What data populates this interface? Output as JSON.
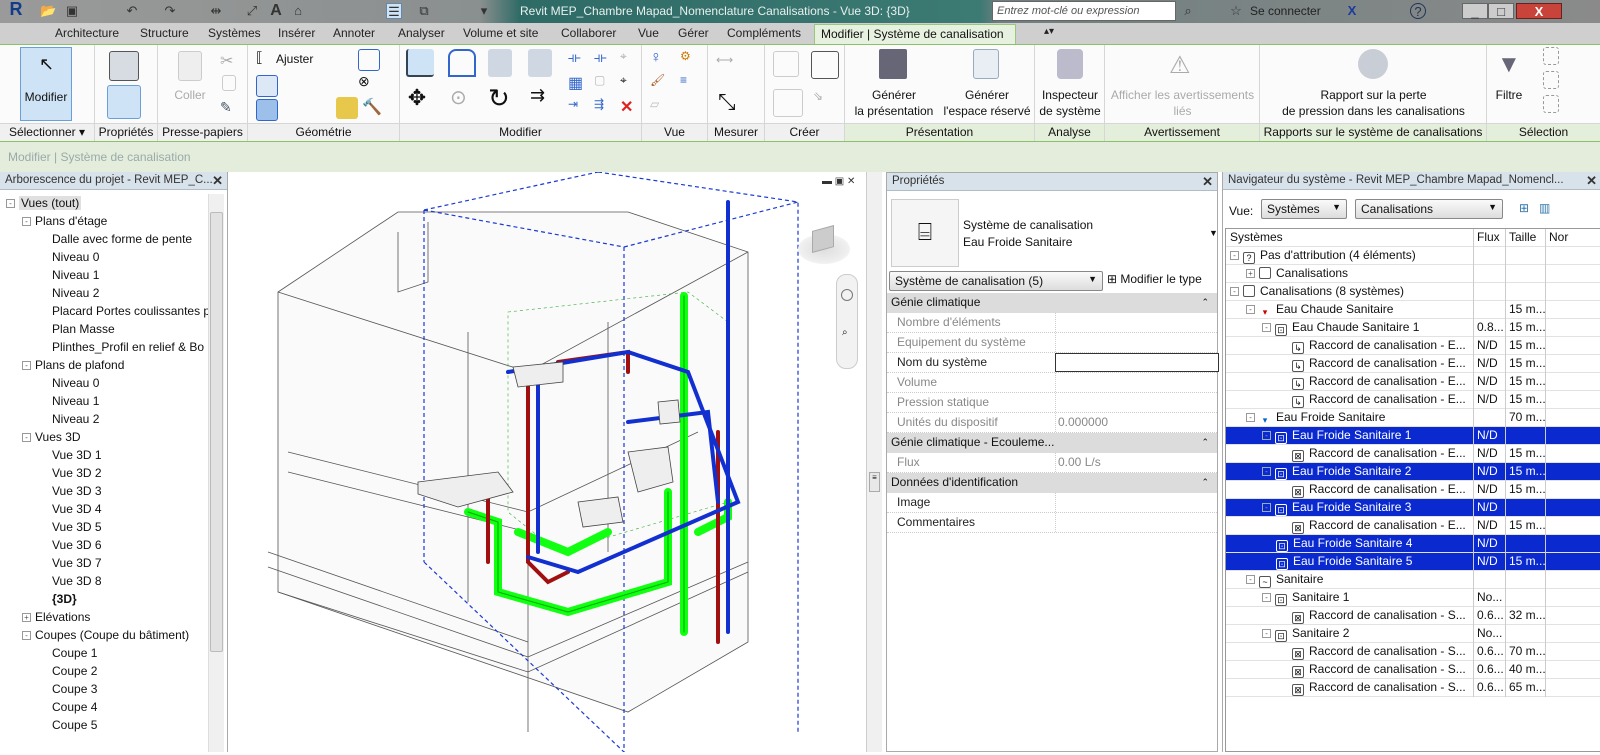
{
  "app": {
    "title": "Revit MEP_Chambre Mapad_Nomenclature Canalisations - Vue 3D: {3D}",
    "search_placeholder": "Entrez mot-clé ou expression",
    "sign_in": "Se connecter"
  },
  "tabs": [
    "Architecture",
    "Structure",
    "Systèmes",
    "Insérer",
    "Annoter",
    "Analyser",
    "Volume et site",
    "Collaborer",
    "Vue",
    "Gérer",
    "Compléments"
  ],
  "active_tab": "Modifier | Système de canalisation",
  "ribbon": {
    "panels": [
      "Sélectionner ▾",
      "Propriétés",
      "Presse-papiers",
      "Géométrie",
      "Modifier",
      "Vue",
      "Mesurer",
      "Créer",
      "Présentation",
      "Analyse",
      "Avertissement",
      "Rapports sur le système de canalisations",
      "Sélection"
    ],
    "modify": "Modifier",
    "paste": "Coller",
    "trim": "Ajuster",
    "gen_layout": [
      "Générer",
      "la présentation"
    ],
    "gen_space": [
      "Générer",
      "l'espace réservé"
    ],
    "inspector": [
      "Inspecteur",
      "de système"
    ],
    "warnings": [
      "Afficher les avertissements",
      "liés"
    ],
    "report": [
      "Rapport sur la perte",
      "de pression dans les canalisations"
    ],
    "filter": "Filtre"
  },
  "options_bar": "Modifier | Système de canalisation",
  "browser": {
    "title": "Arborescence du projet - Revit MEP_C...",
    "items": [
      {
        "l": "Vues (tout)",
        "d": 0,
        "t": "-"
      },
      {
        "l": "Plans d'étage",
        "d": 1,
        "t": "-"
      },
      {
        "l": "Dalle avec forme de pente",
        "d": 2
      },
      {
        "l": "Niveau 0",
        "d": 2
      },
      {
        "l": "Niveau 1",
        "d": 2
      },
      {
        "l": "Niveau 2",
        "d": 2
      },
      {
        "l": "Placard Portes coulissantes pl",
        "d": 2
      },
      {
        "l": "Plan Masse",
        "d": 2
      },
      {
        "l": "Plinthes_Profil en relief & Bo",
        "d": 2
      },
      {
        "l": "Plans de plafond",
        "d": 1,
        "t": "-"
      },
      {
        "l": "Niveau 0",
        "d": 2
      },
      {
        "l": "Niveau 1",
        "d": 2
      },
      {
        "l": "Niveau 2",
        "d": 2
      },
      {
        "l": "Vues 3D",
        "d": 1,
        "t": "-"
      },
      {
        "l": "Vue 3D 1",
        "d": 2
      },
      {
        "l": "Vue 3D 2",
        "d": 2
      },
      {
        "l": "Vue 3D 3",
        "d": 2
      },
      {
        "l": "Vue 3D 4",
        "d": 2
      },
      {
        "l": "Vue 3D 5",
        "d": 2
      },
      {
        "l": "Vue 3D 6",
        "d": 2
      },
      {
        "l": "Vue 3D 7",
        "d": 2
      },
      {
        "l": "Vue 3D 8",
        "d": 2
      },
      {
        "l": "{3D}",
        "d": 2,
        "b": true
      },
      {
        "l": "Elévations",
        "d": 1,
        "t": "+"
      },
      {
        "l": "Coupes (Coupe du bâtiment)",
        "d": 1,
        "t": "-"
      },
      {
        "l": "Coupe 1",
        "d": 2
      },
      {
        "l": "Coupe 2",
        "d": 2
      },
      {
        "l": "Coupe 3",
        "d": 2
      },
      {
        "l": "Coupe 4",
        "d": 2
      },
      {
        "l": "Coupe 5",
        "d": 2
      }
    ]
  },
  "properties": {
    "title": "Propriétés",
    "type_line1": "Système de canalisation",
    "type_line2": "Eau Froide Sanitaire",
    "selector": "Système de canalisation (5)",
    "edit_type": "Modifier le type",
    "groups": [
      {
        "name": "Génie climatique",
        "rows": [
          {
            "k": "Nombre d'éléments",
            "v": ""
          },
          {
            "k": "Equipement du système",
            "v": ""
          },
          {
            "k": "Nom du système",
            "v": "",
            "active": true
          },
          {
            "k": "Volume",
            "v": ""
          },
          {
            "k": "Pression statique",
            "v": ""
          },
          {
            "k": "Unités du dispositif",
            "v": "0.000000"
          }
        ]
      },
      {
        "name": "Génie climatique - Ecouleme...",
        "rows": [
          {
            "k": "Flux",
            "v": "0.00 L/s"
          }
        ]
      },
      {
        "name": "Données d'identification",
        "rows": [
          {
            "k": "Image",
            "v": "",
            "active": true
          },
          {
            "k": "Commentaires",
            "v": "",
            "active": true
          }
        ]
      }
    ]
  },
  "navigator": {
    "title": "Navigateur du système - Revit MEP_Chambre Mapad_Nomencl...",
    "view_label": "Vue:",
    "view_select": "Systèmes",
    "type_select": "Canalisations",
    "columns": [
      "Systèmes",
      "Flux",
      "Taille",
      "Nor"
    ],
    "rows": [
      {
        "l": "Pas d'attribution (4 éléments)",
        "d": 0,
        "t": "-",
        "i": "?"
      },
      {
        "l": "Canalisations",
        "d": 1,
        "t": "+",
        "i": ""
      },
      {
        "l": "Canalisations (8 systèmes)",
        "d": 0,
        "t": "-",
        "i": ""
      },
      {
        "l": "Eau Chaude Sanitaire",
        "d": 1,
        "t": "-",
        "i": "▾",
        "c": "#c00",
        "s": "15 m..."
      },
      {
        "l": "Eau Chaude Sanitaire 1",
        "d": 2,
        "t": "-",
        "i": "⊡",
        "f": "0.8...",
        "s": "15 m..."
      },
      {
        "l": "Raccord de canalisation - E...",
        "d": 3,
        "i": "↳",
        "f": "N/D",
        "s": "15 m..."
      },
      {
        "l": "Raccord de canalisation - E...",
        "d": 3,
        "i": "↳",
        "f": "N/D",
        "s": "15 m..."
      },
      {
        "l": "Raccord de canalisation - E...",
        "d": 3,
        "i": "↳",
        "f": "N/D",
        "s": "15 m..."
      },
      {
        "l": "Raccord de canalisation - E...",
        "d": 3,
        "i": "↳",
        "f": "N/D",
        "s": "15 m..."
      },
      {
        "l": "Eau Froide Sanitaire",
        "d": 1,
        "t": "-",
        "i": "▾",
        "c": "#06c",
        "s": "70 m..."
      },
      {
        "l": "Eau Froide Sanitaire 1",
        "d": 2,
        "t": "-",
        "i": "⊡",
        "f": "N/D",
        "h": true
      },
      {
        "l": "Raccord de canalisation - E...",
        "d": 3,
        "i": "⊠",
        "f": "N/D",
        "s": "15 m..."
      },
      {
        "l": "Eau Froide Sanitaire 2",
        "d": 2,
        "t": "-",
        "i": "⊡",
        "f": "N/D",
        "s": "15 m...",
        "h": true
      },
      {
        "l": "Raccord de canalisation - E...",
        "d": 3,
        "i": "⊠",
        "f": "N/D",
        "s": "15 m..."
      },
      {
        "l": "Eau Froide Sanitaire 3",
        "d": 2,
        "t": "-",
        "i": "⊡",
        "f": "N/D",
        "h": true
      },
      {
        "l": "Raccord de canalisation - E...",
        "d": 3,
        "i": "⊠",
        "f": "N/D",
        "s": "15 m..."
      },
      {
        "l": "Eau Froide Sanitaire 4",
        "d": 2,
        "i": "⊡",
        "f": "N/D",
        "h": true
      },
      {
        "l": "Eau Froide Sanitaire 5",
        "d": 2,
        "i": "⊡",
        "f": "N/D",
        "s": "15 m...",
        "h": true
      },
      {
        "l": "Sanitaire",
        "d": 1,
        "t": "-",
        "i": "~"
      },
      {
        "l": "Sanitaire 1",
        "d": 2,
        "t": "-",
        "i": "⊡",
        "f": "No..."
      },
      {
        "l": "Raccord de canalisation - S...",
        "d": 3,
        "i": "⊠",
        "f": "0.6...",
        "s": "32 m..."
      },
      {
        "l": "Sanitaire 2",
        "d": 2,
        "t": "-",
        "i": "⊡",
        "f": "No..."
      },
      {
        "l": "Raccord de canalisation - S...",
        "d": 3,
        "i": "⊠",
        "f": "0.6...",
        "s": "70 m..."
      },
      {
        "l": "Raccord de canalisation - S...",
        "d": 3,
        "i": "⊠",
        "f": "0.6...",
        "s": "40 m..."
      },
      {
        "l": "Raccord de canalisation - S...",
        "d": 3,
        "i": "⊠",
        "f": "0.6...",
        "s": "65 m..."
      }
    ]
  },
  "colors": {
    "selection": "#0a2ad0",
    "hot": "#b01818",
    "cold": "#1030c8",
    "waste": "#22dd22",
    "contextual": "#e3eedb"
  }
}
